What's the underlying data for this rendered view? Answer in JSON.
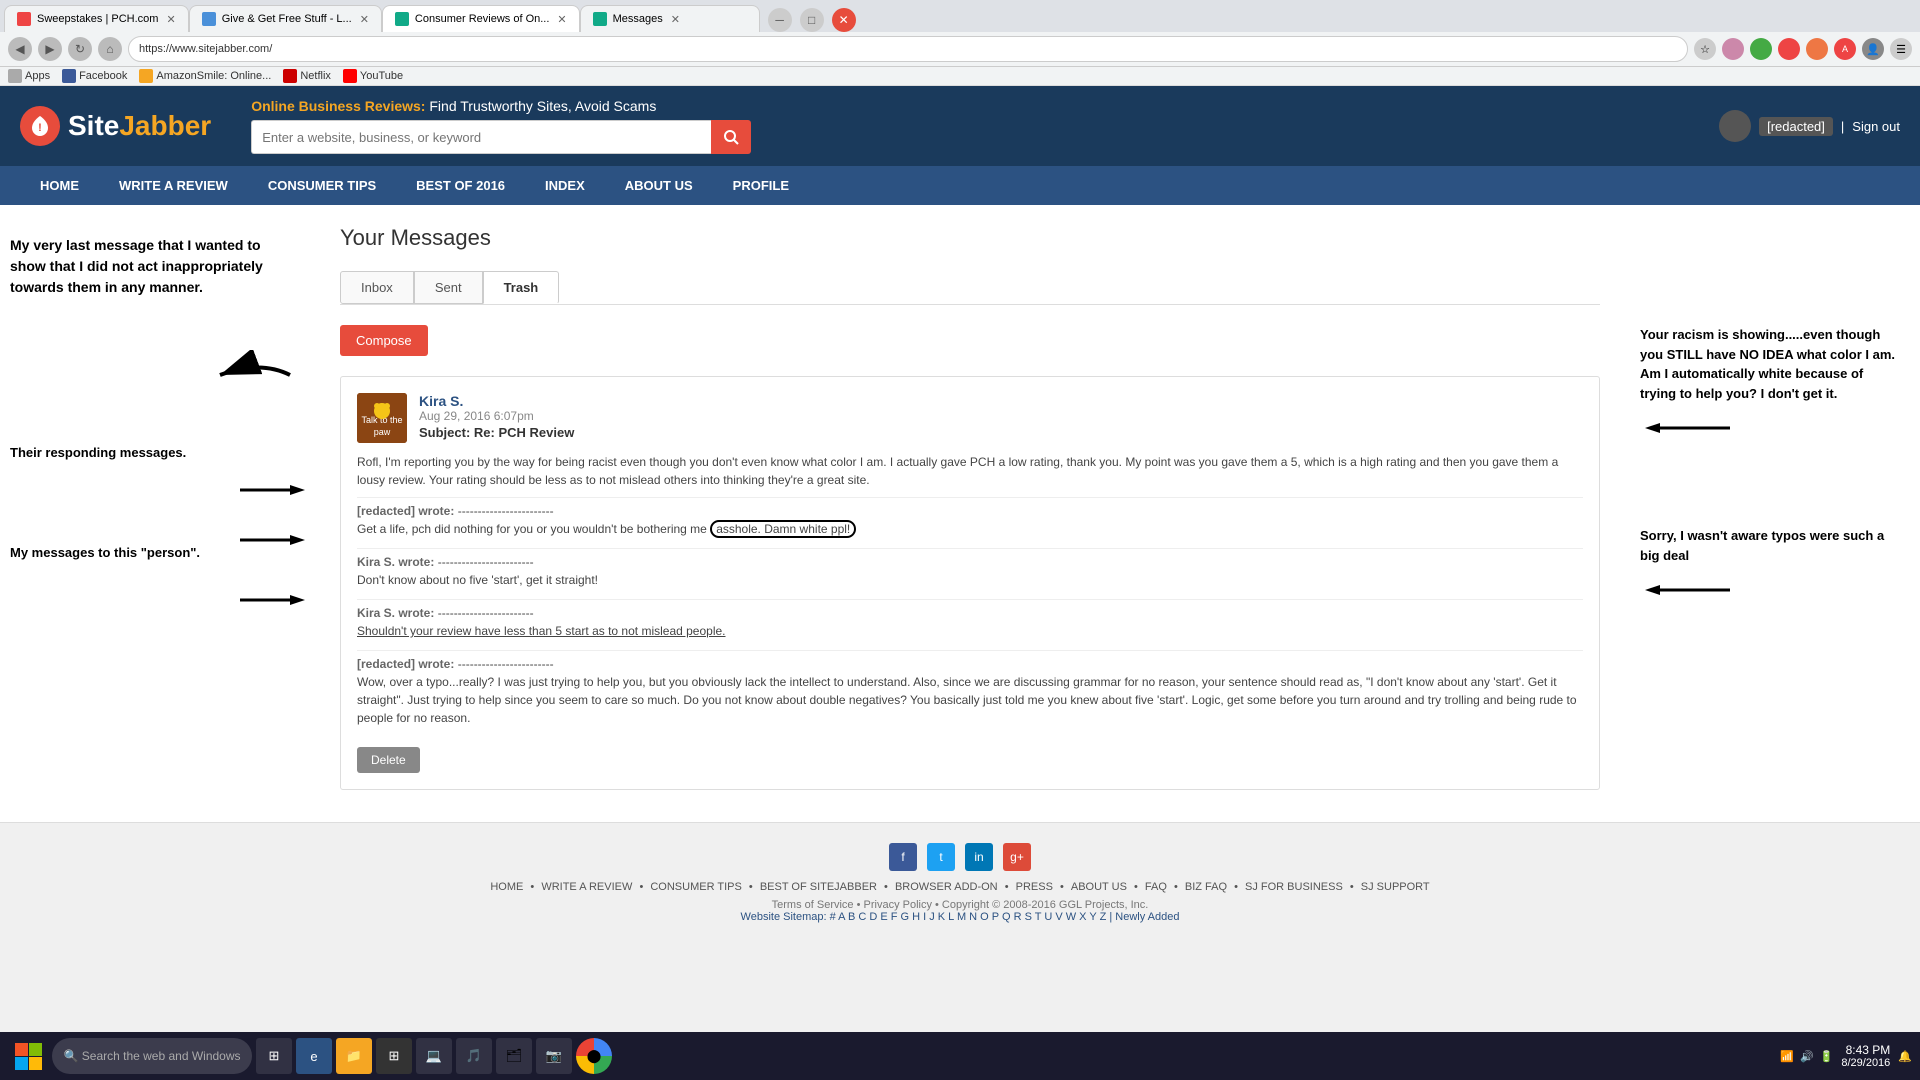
{
  "browser": {
    "tabs": [
      {
        "label": "Sweepstakes | PCH.com",
        "favicon_color": "#e44",
        "active": false
      },
      {
        "label": "Give & Get Free Stuff - L...",
        "favicon_color": "#4a90d9",
        "active": false
      },
      {
        "label": "Consumer Reviews of On...",
        "favicon_color": "#1a8",
        "active": true
      },
      {
        "label": "Messages",
        "favicon_color": "#1a8",
        "active": false
      }
    ],
    "address": "https://www.sitejabber.com/",
    "bookmarks": [
      {
        "label": "Apps",
        "color": "#aaa"
      },
      {
        "label": "Facebook",
        "color": "#3b5998"
      },
      {
        "label": "AmazonSmile: Online...",
        "color": "#f5a623"
      },
      {
        "label": "Netflix",
        "color": "#c00"
      },
      {
        "label": "YouTube",
        "color": "#f00"
      }
    ]
  },
  "header": {
    "logo_text_site": "Site",
    "logo_text_jabber": "Jabber",
    "tagline_label": "Online Business Reviews:",
    "tagline_sub": "Find Trustworthy Sites, Avoid Scams",
    "search_placeholder": "Enter a website, business, or keyword",
    "sign_out": "Sign out"
  },
  "nav": {
    "items": [
      {
        "label": "HOME",
        "id": "home"
      },
      {
        "label": "WRITE A REVIEW",
        "id": "write-review"
      },
      {
        "label": "CONSUMER TIPS",
        "id": "consumer-tips"
      },
      {
        "label": "BEST OF 2016",
        "id": "best-of-2016"
      },
      {
        "label": "INDEX",
        "id": "index"
      },
      {
        "label": "ABOUT US",
        "id": "about-us"
      },
      {
        "label": "PROFILE",
        "id": "profile"
      }
    ]
  },
  "messages_page": {
    "title": "Your Messages",
    "tabs": [
      {
        "label": "Inbox",
        "id": "inbox",
        "active": false
      },
      {
        "label": "Sent",
        "id": "sent",
        "active": false
      },
      {
        "label": "Trash",
        "id": "trash",
        "active": true
      }
    ],
    "compose_label": "Compose",
    "message": {
      "sender": "Kira S.",
      "date": "Aug 29, 2016 6:07pm",
      "subject": "Subject: Re: PCH Review",
      "body": "Rofl, I'm reporting you by the way for being racist even though you don't even know what color I am. I actually gave PCH a low rating, thank you. My point was you gave them a 5, which is a high rating and then you gave them a lousy review. Your rating should be less as to not mislead others into thinking they're a great site.",
      "thread": [
        {
          "writer": "[redacted] wrote:",
          "separator": "------------------------",
          "text": "Get a life, pch did nothing for you or you wouldn't be bothering me asshole. Damn white ppl!"
        },
        {
          "writer": "Kira S. wrote:",
          "separator": "------------------------",
          "text": "Don't know about no five 'start', get it straight!"
        },
        {
          "writer": "Kira S. wrote:",
          "separator": "------------------------",
          "text": "Shouldn't your review have less than 5 start as to not mislead people."
        },
        {
          "writer": "[redacted] wrote:",
          "separator": "------------------------",
          "text": "Wow, over a typo...really? I was just trying to help you, but you obviously lack the intellect to understand. Also, since we are discussing grammar for no reason, your sentence should read as, \"I don't know about any 'start'. Get it straight\". Just trying to help since you seem to care so much. Do you not know about double negatives? You basically just told me you knew about five 'start'. Logic, get some before you turn around and try trolling and being rude to people for no reason."
        }
      ],
      "delete_label": "Delete"
    }
  },
  "annotations": {
    "left_note": "My very last message that I wanted to show that I did not act inappropriately towards them in any manner.",
    "their_messages": "Their responding messages.",
    "my_messages": "My messages to this \"person\".",
    "racism_note": "Your racism is showing.....even though you STILL have NO IDEA what color I am.  Am I automatically white because of trying to help you?  I don't get it.",
    "typo_note": "Sorry, I wasn't aware typos were such a big deal"
  },
  "footer": {
    "nav_items": [
      "HOME",
      "WRITE A REVIEW",
      "CONSUMER TIPS",
      "BEST OF SITEJABBER",
      "BROWSER ADD-ON",
      "PRESS",
      "ABOUT US",
      "FAQ",
      "BIZ FAQ",
      "SJ FOR BUSINESS",
      "SJ SUPPORT"
    ],
    "legal": "Terms of Service  •  Privacy Policy  •  Copyright © 2008-2016 GGL Projects, Inc.",
    "sitemap": "Website Sitemap: # A B C D E F G H I J K L M N O P Q R S T U V W X Y Z | Newly Added"
  },
  "taskbar": {
    "time": "8:43 PM",
    "date": "8/29/2016"
  }
}
